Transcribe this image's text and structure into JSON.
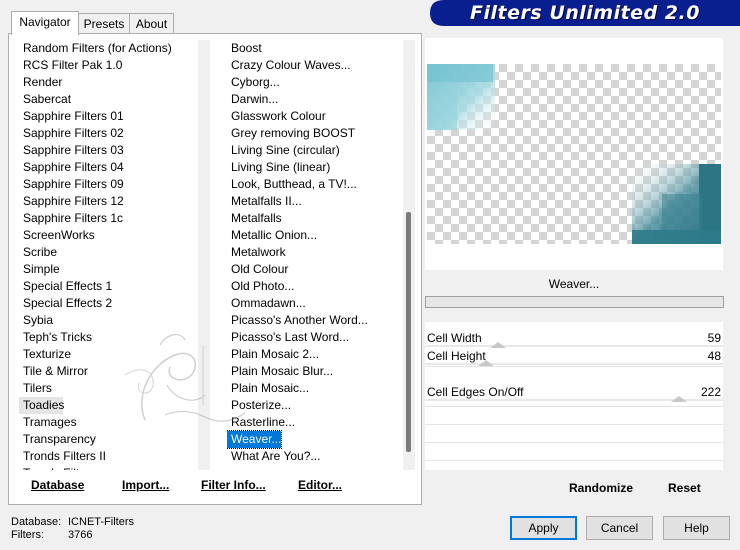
{
  "tabs": [
    {
      "label": "Navigator",
      "active": true
    },
    {
      "label": "Presets",
      "active": false
    },
    {
      "label": "About",
      "active": false
    }
  ],
  "title": "Filters Unlimited 2.0",
  "categories": [
    "Random Filters (for Actions)",
    "RCS Filter Pak 1.0",
    "Render",
    "Sabercat",
    "Sapphire Filters 01",
    "Sapphire Filters 02",
    "Sapphire Filters 03",
    "Sapphire Filters 04",
    "Sapphire Filters 09",
    "Sapphire Filters 12",
    "Sapphire Filters 1c",
    "ScreenWorks",
    "Scribe",
    "Simple",
    "Special Effects 1",
    "Special Effects 2",
    "Sybia",
    "Teph's Tricks",
    "Texturize",
    "Tile & Mirror",
    "Tilers",
    "Toadies",
    "Tramages",
    "Transparency",
    "Tronds Filters II",
    "Tronds Filters"
  ],
  "selected_category": "Toadies",
  "filters": [
    "Boost",
    "Crazy Colour Waves...",
    "Cyborg...",
    "Darwin...",
    "Glasswork Colour",
    "Grey removing BOOST",
    "Living Sine (circular)",
    "Living Sine (linear)",
    "Look, Butthead, a TV!...",
    "Metalfalls II...",
    "Metalfalls",
    "Metallic Onion...",
    "Metalwork",
    "Old Colour",
    "Old Photo...",
    "Ommadawn...",
    "Picasso's Another Word...",
    "Picasso's Last Word...",
    "Plain Mosaic 2...",
    "Plain Mosaic Blur...",
    "Plain Mosaic...",
    "Posterize...",
    "Rasterline...",
    "Weaver...",
    "What Are You?..."
  ],
  "selected_filter": "Weaver...",
  "panel_buttons": {
    "database": "Database",
    "import": "Import...",
    "filter_info": "Filter Info...",
    "editor": "Editor..."
  },
  "current_filter_name": "Weaver...",
  "parameters": [
    {
      "label": "Cell Width",
      "value": "59",
      "max": 255
    },
    {
      "label": "Cell Height",
      "value": "48",
      "max": 255
    },
    {
      "label": "Cell Edges On/Off",
      "value": "222",
      "max": 255
    }
  ],
  "right_buttons": {
    "randomize": "Randomize",
    "reset": "Reset"
  },
  "status": {
    "database_label": "Database:",
    "database_value": "ICNET-Filters",
    "filters_label": "Filters:",
    "filters_value": "3766"
  },
  "dialog_buttons": {
    "apply": "Apply",
    "cancel": "Cancel",
    "help": "Help"
  },
  "colors": {
    "banner": "#0a1f8f",
    "selection": "#0078d7",
    "preview_teal": "#2e7a8a"
  }
}
